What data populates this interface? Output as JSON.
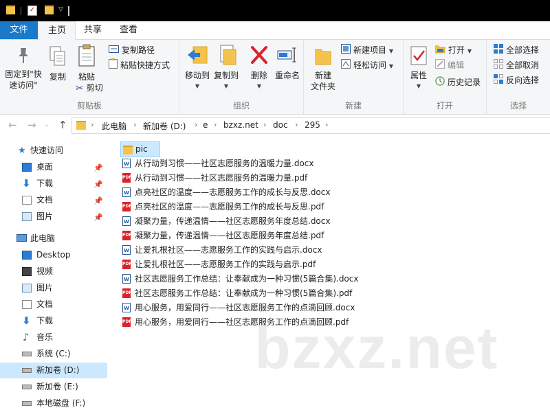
{
  "ribbon_tabs": {
    "file": "文件",
    "home": "主页",
    "share": "共享",
    "view": "查看"
  },
  "clipboard": {
    "pin": "固定到\"快",
    "pin2": "速访问\"",
    "copy": "复制",
    "paste": "粘贴",
    "copy_path": "复制路径",
    "paste_shortcut": "粘贴快捷方式",
    "cut": "剪切",
    "label": "剪贴板"
  },
  "organize": {
    "move_to": "移动到",
    "copy_to": "复制到",
    "delete": "删除",
    "rename": "重命名",
    "label": "组织"
  },
  "new_group": {
    "new_folder": "新建",
    "new_folder2": "文件夹",
    "new_item": "新建项目",
    "easy_access": "轻松访问",
    "label": "新建"
  },
  "open_group": {
    "properties": "属性",
    "open": "打开",
    "edit": "编辑",
    "history": "历史记录",
    "label": "打开"
  },
  "select_group": {
    "select_all": "全部选择",
    "select_none": "全部取消",
    "invert": "反向选择",
    "label": "选择"
  },
  "address": {
    "crumbs": [
      "此电脑",
      "新加卷 (D:)",
      "e",
      "bzxz.net",
      "doc",
      "295"
    ]
  },
  "nav": {
    "quick_access": "快速访问",
    "desktop_q": "桌面",
    "downloads_q": "下载",
    "documents_q": "文档",
    "pictures_q": "图片",
    "this_pc": "此电脑",
    "desktop": "Desktop",
    "videos": "视频",
    "pictures": "图片",
    "documents": "文档",
    "downloads": "下载",
    "music": "音乐",
    "drive_c": "系统 (C:)",
    "drive_d": "新加卷 (D:)",
    "drive_e": "新加卷 (E:)",
    "drive_f": "本地磁盘 (F:)"
  },
  "files": [
    {
      "name": "pic",
      "type": "folder"
    },
    {
      "name": "从行动到习惯——社区志愿服务的温暖力量.docx",
      "type": "docx"
    },
    {
      "name": "从行动到习惯——社区志愿服务的温暖力量.pdf",
      "type": "pdf"
    },
    {
      "name": "点亮社区的温度——志愿服务工作的成长与反思.docx",
      "type": "docx"
    },
    {
      "name": "点亮社区的温度——志愿服务工作的成长与反思.pdf",
      "type": "pdf"
    },
    {
      "name": "凝聚力量，传递温情——社区志愿服务年度总结.docx",
      "type": "docx"
    },
    {
      "name": "凝聚力量，传递温情——社区志愿服务年度总结.pdf",
      "type": "pdf"
    },
    {
      "name": "让爱扎根社区——志愿服务工作的实践与启示.docx",
      "type": "docx"
    },
    {
      "name": "让爱扎根社区——志愿服务工作的实践与启示.pdf",
      "type": "pdf"
    },
    {
      "name": "社区志愿服务工作总结：让奉献成为一种习惯(5篇合集).docx",
      "type": "docx"
    },
    {
      "name": "社区志愿服务工作总结：让奉献成为一种习惯(5篇合集).pdf",
      "type": "pdf"
    },
    {
      "name": "用心服务，用爱同行——社区志愿服务工作的点滴回顾.docx",
      "type": "docx"
    },
    {
      "name": "用心服务，用爱同行——社区志愿服务工作的点滴回顾.pdf",
      "type": "pdf"
    }
  ],
  "watermark": "bzxz.net",
  "colors": {
    "file_tab": "#1979ca",
    "selection": "#cce8ff",
    "folder": "#f4c34e",
    "pdf": "#d9232a",
    "docx": "#2b5797"
  }
}
